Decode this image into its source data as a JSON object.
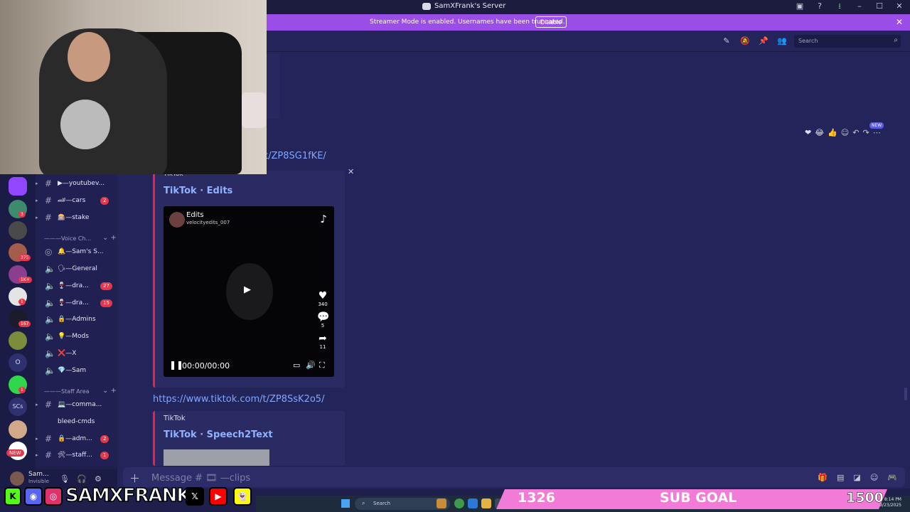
{
  "window": {
    "title": "SamXFrank's Server"
  },
  "banner": {
    "text": "Streamer Mode is enabled. Usernames have been truncated.",
    "button": "Disable"
  },
  "header": {
    "search_placeholder": "Search"
  },
  "messages": {
    "top_link": "t/ZP8SG1fKE/",
    "reactions_new_badge": "NEW",
    "embed1": {
      "provider": "TikTok",
      "title": "TikTok · Edits",
      "video": {
        "author": "Edits",
        "username": "velocityedits_007",
        "likes": "340",
        "comments": "5",
        "shares": "11",
        "time": "00:00/00:00"
      }
    },
    "link2": "https://www.tiktok.com/t/ZP8SsK2o5/",
    "embed2": {
      "provider": "TikTok",
      "title": "TikTok · Speech2Text"
    }
  },
  "composer": {
    "placeholder": "Message # 🎞 —clips"
  },
  "servers": {
    "badges": [
      "3",
      "375",
      "1K+",
      "1",
      "167",
      "1"
    ],
    "text_icons": [
      "O",
      "SCs"
    ],
    "new_label": "NEW"
  },
  "channels": {
    "items": [
      {
        "name": "▶—youtubev...",
        "badge": ""
      },
      {
        "name": "🏎—cars",
        "badge": "2"
      },
      {
        "name": "🎰—stake",
        "badge": ""
      }
    ],
    "voice_category": "———Voice Ch...",
    "voice_items": [
      {
        "name": "🔔—Sam's S...",
        "badge": ""
      },
      {
        "name": "🗣—General",
        "badge": ""
      },
      {
        "name": "🍷—dra...",
        "badge": "27"
      },
      {
        "name": "🍷—dra...",
        "badge": "15"
      },
      {
        "name": "🔒—Admins",
        "badge": ""
      },
      {
        "name": "💡—Mods",
        "badge": ""
      },
      {
        "name": "❌—X",
        "badge": ""
      },
      {
        "name": "💎—Sam",
        "badge": ""
      }
    ],
    "staff_category": "———Staff Area",
    "staff_items": [
      {
        "name": "💻—comma...",
        "badge": ""
      },
      {
        "name": "bleed-cmds",
        "badge": ""
      },
      {
        "name": "🔒—adm...",
        "badge": "2"
      },
      {
        "name": "🛠—staff...",
        "badge": "1"
      }
    ]
  },
  "user": {
    "name": "Sam...",
    "status": "Invisible"
  },
  "overlay": {
    "handle": "SAMXFRANK",
    "sub_current": "1326",
    "sub_label": "SUB GOAL",
    "sub_target": "1500"
  },
  "taskbar": {
    "search": "Search",
    "time": "8:14 PM",
    "date": "9/23/2025"
  },
  "colors": {
    "accent": "#9b4de8",
    "tiktok": "#ee1d52",
    "link": "#7fa7ff",
    "sub_goal": "#f27bd7"
  }
}
